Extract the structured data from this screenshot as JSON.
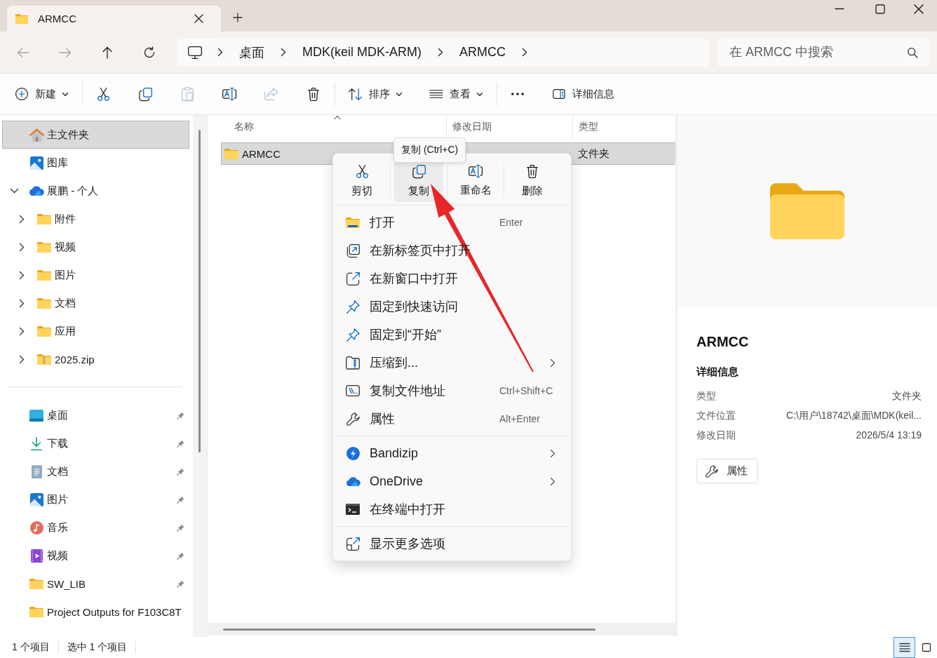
{
  "title_bar": {
    "tab_title": "ARMCC"
  },
  "navigation": {
    "buttons": [
      {
        "disabled": true
      },
      {
        "disabled": true
      },
      {
        "disabled": false
      },
      {
        "disabled": false
      }
    ],
    "breadcrumbs": [
      "桌面",
      "MDK(keil MDK-ARM)",
      "ARMCC"
    ],
    "search": {
      "placeholder": "在 ARMCC 中搜索"
    }
  },
  "toolbar": {
    "groups": [
      [
        {
          "label": "新建",
          "disabled": false,
          "dropdown": true
        }
      ],
      [
        {
          "disabled": false,
          "dropdown": false
        },
        {
          "disabled": false,
          "dropdown": false
        },
        {
          "disabled": true,
          "dropdown": false
        },
        {
          "disabled": false,
          "dropdown": false
        },
        {
          "disabled": true,
          "dropdown": false
        },
        {
          "disabled": false,
          "dropdown": false
        }
      ],
      [
        {
          "label": "排序",
          "disabled": false,
          "dropdown": true
        },
        {
          "label": "查看",
          "disabled": false,
          "dropdown": true
        }
      ],
      [
        {
          "disabled": false,
          "dropdown": false
        }
      ]
    ],
    "details_button": {
      "label": "详细信息"
    }
  },
  "sidebar": {
    "items": [
      {
        "label": "主文件夹",
        "selected": true
      },
      {
        "label": "图库",
        "selected": false
      },
      {
        "label": "展鹏 - 个人",
        "selected": false,
        "expanded": true,
        "children": [
          {
            "label": "附件",
            "selected": false,
            "expanded": false
          },
          {
            "label": "视频",
            "selected": false,
            "expanded": false
          },
          {
            "label": "图片",
            "selected": false,
            "expanded": false
          },
          {
            "label": "文档",
            "selected": false,
            "expanded": false
          },
          {
            "label": "应用",
            "selected": false,
            "expanded": false
          },
          {
            "label": "2025.zip",
            "selected": false,
            "expanded": false
          }
        ]
      }
    ],
    "quick_access": [
      {
        "label": "桌面",
        "selected": false,
        "pinned": true
      },
      {
        "label": "下载",
        "selected": false,
        "pinned": true
      },
      {
        "label": "文档",
        "selected": false,
        "pinned": true
      },
      {
        "label": "图片",
        "selected": false,
        "pinned": true
      },
      {
        "label": "音乐",
        "selected": false,
        "pinned": true
      },
      {
        "label": "视频",
        "selected": false,
        "pinned": true
      },
      {
        "label": "SW_LIB",
        "selected": false,
        "pinned": true
      },
      {
        "label": "Project Outputs for F103C8T",
        "selected": false,
        "pinned": false
      }
    ]
  },
  "file_list": {
    "columns": [
      {
        "label": "名称",
        "sorted": true
      },
      {
        "label": "修改日期",
        "sorted": false
      },
      {
        "label": "类型",
        "sorted": false
      }
    ],
    "rows": [
      {
        "name": "ARMCC",
        "type": "文件夹",
        "selected": true
      }
    ]
  },
  "details_pane": {
    "title": "ARMCC",
    "heading": "详细信息",
    "properties": [
      {
        "label": "类型",
        "value": "文件夹"
      },
      {
        "label": "文件位置",
        "value": "C:\\用户\\18742\\桌面\\MDK(keil..."
      },
      {
        "label": "修改日期",
        "value": "2026/5/4 13:19"
      }
    ],
    "button": "属性"
  },
  "context_menu": {
    "actions": [
      {
        "label": "剪切",
        "hovered": false
      },
      {
        "label": "复制",
        "hovered": true
      },
      {
        "label": "重命名",
        "hovered": false
      },
      {
        "label": "删除",
        "hovered": false
      }
    ],
    "tooltip": "复制 (Ctrl+C)",
    "sections": [
      [
        {
          "label": "打开",
          "shortcut": "Enter",
          "submenu": false
        },
        {
          "label": "在新标签页中打开",
          "submenu": false
        },
        {
          "label": "在新窗口中打开",
          "submenu": false
        },
        {
          "label": "固定到快速访问",
          "submenu": false
        },
        {
          "label": "固定到“开始”",
          "submenu": false
        },
        {
          "label": "压缩到...",
          "submenu": true
        },
        {
          "label": "复制文件地址",
          "shortcut": "Ctrl+Shift+C",
          "submenu": false
        },
        {
          "label": "属性",
          "shortcut": "Alt+Enter",
          "submenu": false
        }
      ],
      [
        {
          "label": "Bandizip",
          "submenu": true
        },
        {
          "label": "OneDrive",
          "submenu": true
        },
        {
          "label": "在终端中打开",
          "submenu": false
        }
      ],
      [
        {
          "label": "显示更多选项",
          "submenu": false
        }
      ]
    ]
  },
  "annotation": {
    "kind": "arrow"
  },
  "status_bar": {
    "items": [
      "1 个项目",
      "选中 1 个项目"
    ],
    "views": [
      {
        "selected": true
      },
      {
        "selected": false
      }
    ]
  }
}
